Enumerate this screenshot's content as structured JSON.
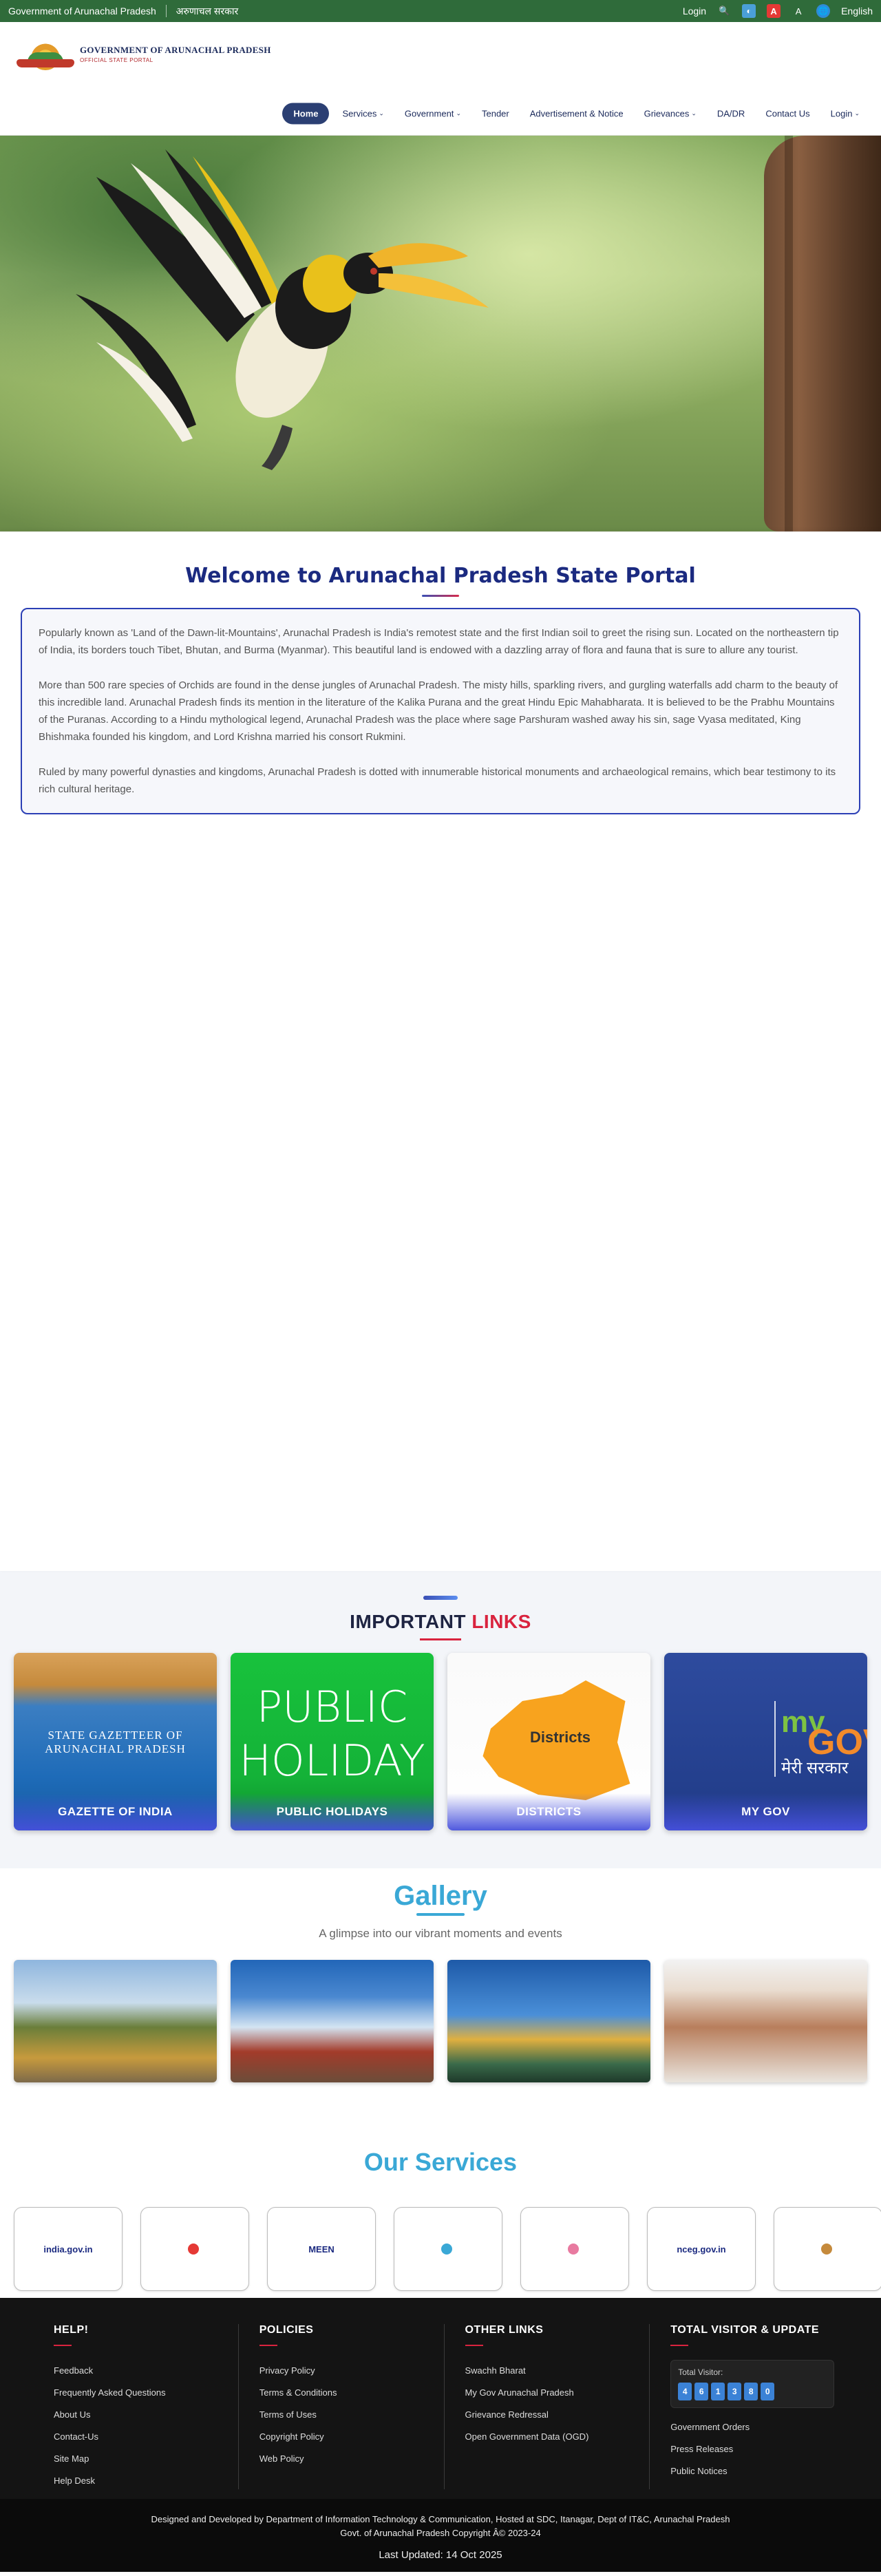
{
  "topbar": {
    "gov_label": "Government of Arunachal Pradesh",
    "hindi_label": "अरुणाचल सरकार",
    "login": "Login",
    "font_a_big": "A",
    "font_a": "A",
    "language": "English"
  },
  "header": {
    "logo_title": "GOVERNMENT OF ARUNACHAL PRADESH",
    "logo_subtitle": "OFFICIAL STATE PORTAL"
  },
  "nav": [
    {
      "label": "Home",
      "active": true
    },
    {
      "label": "Services",
      "dropdown": true
    },
    {
      "label": "Government",
      "dropdown": true
    },
    {
      "label": "Tender"
    },
    {
      "label": "Advertisement & Notice"
    },
    {
      "label": "Grievances",
      "dropdown": true
    },
    {
      "label": "DA/DR"
    },
    {
      "label": "Contact Us"
    },
    {
      "label": "Login",
      "dropdown": true
    }
  ],
  "welcome": {
    "title": "Welcome to Arunachal Pradesh State Portal",
    "p1": "Popularly known as 'Land of the Dawn-lit-Mountains', Arunachal Pradesh is India's remotest state and the first Indian soil to greet the rising sun. Located on the northeastern tip of India, its borders touch Tibet, Bhutan, and Burma (Myanmar). This beautiful land is endowed with a dazzling array of flora and fauna that is sure to allure any tourist.",
    "p2": "More than 500 rare species of Orchids are found in the dense jungles of Arunachal Pradesh. The misty hills, sparkling rivers, and gurgling waterfalls add charm to the beauty of this incredible land. Arunachal Pradesh finds its mention in the literature of the Kalika Purana and the great Hindu Epic Mahabharata. It is believed to be the Prabhu Mountains of the Puranas. According to a Hindu mythological legend, Arunachal Pradesh was the place where sage Parshuram washed away his sin, sage Vyasa meditated, King Bhishmaka founded his kingdom, and Lord Krishna married his consort Rukmini.",
    "p3": "Ruled by many powerful dynasties and kingdoms, Arunachal Pradesh is dotted with innumerable historical monuments and archaeological remains, which bear testimony to its rich cultural heritage."
  },
  "important": {
    "title_a": "IMPORTANT ",
    "title_b": "LINKS",
    "cards": [
      {
        "caption": "GAZETTE OF INDIA",
        "art_text_1": "STATE GAZETTEER OF",
        "art_text_2": "ARUNACHAL PRADESH"
      },
      {
        "caption": "PUBLIC HOLIDAYS",
        "art_text_1": "PUBLIC",
        "art_text_2": "HOLIDAY"
      },
      {
        "caption": "DISTRICTS",
        "art_text_1": "Districts"
      },
      {
        "caption": "MY GOV",
        "art_text_1": "my",
        "art_text_2": "GOV",
        "art_text_3": "मेरी सरकार"
      }
    ]
  },
  "gallery": {
    "title": "Gallery",
    "subtitle": "A glimpse into our vibrant moments and events"
  },
  "services": {
    "title": "Our Services",
    "items": [
      "india.gov.in",
      "",
      "MEEN",
      "",
      "",
      "nceg.gov.in",
      ""
    ]
  },
  "footer": {
    "help_title": "HELP!",
    "help_links": [
      "Feedback",
      "Frequently Asked Questions",
      "About Us",
      "Contact-Us",
      "Site Map",
      "Help Desk"
    ],
    "policies_title": "POLICIES",
    "policies_links": [
      "Privacy Policy",
      "Terms & Conditions",
      "Terms of Uses",
      "Copyright Policy",
      "Web Policy"
    ],
    "other_title": "OTHER LINKS",
    "other_links": [
      "Swachh Bharat",
      "My Gov Arunachal Pradesh",
      "Grievance Redressal",
      "Open Government Data (OGD)"
    ],
    "visitor_title": "TOTAL VISITOR & UPDATE",
    "visitor_label": "Total Visitor:",
    "visitor_digits": [
      "4",
      "6",
      "1",
      "3",
      "8",
      "0"
    ],
    "update_links": [
      "Government Orders",
      "Press Releases",
      "Public Notices"
    ],
    "credit_line": "Designed and Developed by Department of Information Technology & Communication, Hosted at SDC, Itanagar, Dept of IT&C, Arunachal Pradesh",
    "copyright_line": "Govt. of Arunachal Pradesh Copyright Â© 2023-24",
    "last_updated": "Last Updated: 14 Oct 2025"
  }
}
